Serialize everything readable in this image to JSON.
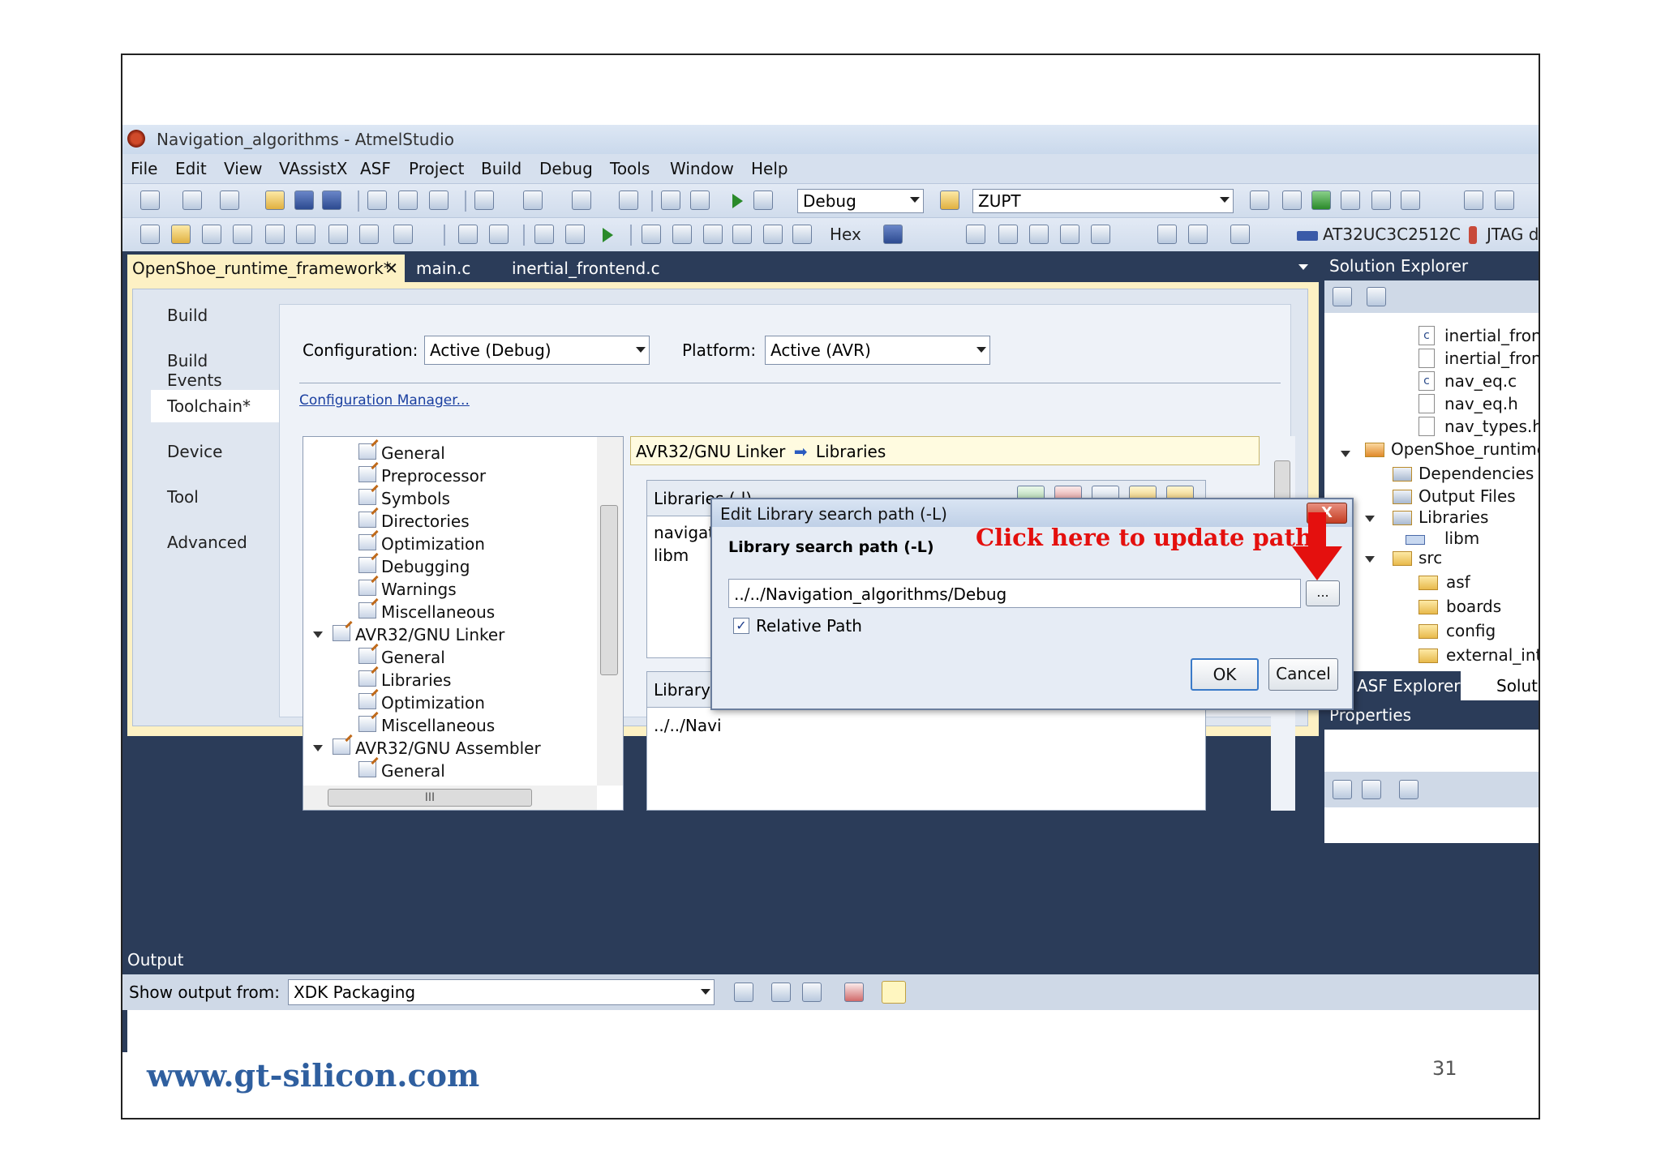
{
  "window": {
    "title": "Navigation_algorithms - AtmelStudio"
  },
  "menu": [
    "File",
    "Edit",
    "View",
    "VAssistX",
    "ASF",
    "Project",
    "Build",
    "Debug",
    "Tools",
    "Window",
    "Help"
  ],
  "toolbar": {
    "config_combo": "Debug",
    "target_combo": "ZUPT",
    "hex_label": "Hex",
    "device_label": "AT32UC3C2512C",
    "tool_label": "JTAG d"
  },
  "doc_tabs": [
    "OpenShoe_runtime_framework*",
    "main.c",
    "inertial_frontend.c"
  ],
  "doc_tab_close": "✕",
  "prop_tabs": [
    "Build",
    "Build Events",
    "Toolchain*",
    "Device",
    "Tool",
    "Advanced"
  ],
  "config": {
    "config_label": "Configuration:",
    "config_value": "Active (Debug)",
    "platform_label": "Platform:",
    "platform_value": "Active (AVR)",
    "config_manager_link": "Configuration Manager..."
  },
  "tree": [
    {
      "label": "General",
      "level": 2
    },
    {
      "label": "Preprocessor",
      "level": 2
    },
    {
      "label": "Symbols",
      "level": 2
    },
    {
      "label": "Directories",
      "level": 2
    },
    {
      "label": "Optimization",
      "level": 2
    },
    {
      "label": "Debugging",
      "level": 2
    },
    {
      "label": "Warnings",
      "level": 2
    },
    {
      "label": "Miscellaneous",
      "level": 2
    },
    {
      "label": "AVR32/GNU Linker",
      "level": 1
    },
    {
      "label": "General",
      "level": 2
    },
    {
      "label": "Libraries",
      "level": 2
    },
    {
      "label": "Optimization",
      "level": 2
    },
    {
      "label": "Miscellaneous",
      "level": 2
    },
    {
      "label": "AVR32/GNU Assembler",
      "level": 1
    },
    {
      "label": "General",
      "level": 2
    }
  ],
  "tree_hscroll_grip": "III",
  "breadcrumb": {
    "part1": "AVR32/GNU Linker",
    "arrow": "➡",
    "part2": "Libraries"
  },
  "libraries_group": {
    "label": "Libraries (-l)",
    "items": [
      "navigatio",
      "libm"
    ]
  },
  "libsearch_group": {
    "label": "Library s",
    "items": [
      "../../Navi"
    ]
  },
  "dialog": {
    "title": "Edit Library search path (-L)",
    "close": "X",
    "field_label": "Library search path (-L)",
    "path_value": "../../Navigation_algorithms/Debug",
    "browse_label": "...",
    "relative_label": "Relative Path",
    "relative_checked": true,
    "ok_label": "OK",
    "cancel_label": "Cancel"
  },
  "annotation": "Click here to update path",
  "solution_explorer": {
    "title": "Solution Explorer",
    "items": [
      {
        "label": "inertial_fron",
        "icon": "c-file-icon"
      },
      {
        "label": "inertial_fron",
        "icon": "h-file-icon"
      },
      {
        "label": "nav_eq.c",
        "icon": "c-file-icon"
      },
      {
        "label": "nav_eq.h",
        "icon": "h-file-icon"
      },
      {
        "label": "nav_types.h",
        "icon": "h-file-icon"
      },
      {
        "label": "OpenShoe_runtime",
        "icon": "project-icon"
      },
      {
        "label": "Dependencies",
        "icon": "folder-icon"
      },
      {
        "label": "Output Files",
        "icon": "folder-icon"
      },
      {
        "label": "Libraries",
        "icon": "folder-icon"
      },
      {
        "label": "libm",
        "icon": "lib-icon"
      },
      {
        "label": "src",
        "icon": "folder-icon"
      },
      {
        "label": "asf",
        "icon": "folder-icon"
      },
      {
        "label": "boards",
        "icon": "folder-icon"
      },
      {
        "label": "config",
        "icon": "folder-icon"
      },
      {
        "label": "external_int",
        "icon": "folder-icon"
      }
    ],
    "bottom_tabs": [
      "ASF Explorer",
      "Soluti"
    ]
  },
  "properties": {
    "title": "Properties"
  },
  "output": {
    "title": "Output",
    "show_label": "Show output from:",
    "source_value": "XDK Packaging"
  },
  "footer": {
    "url": "www.gt-silicon.com",
    "page": "31"
  },
  "colors": {
    "accent_dark": "#2b3c59",
    "doc_bg": "#fdf1c4",
    "annotation_red": "#e4100e",
    "url_blue": "#2f5f9f"
  }
}
